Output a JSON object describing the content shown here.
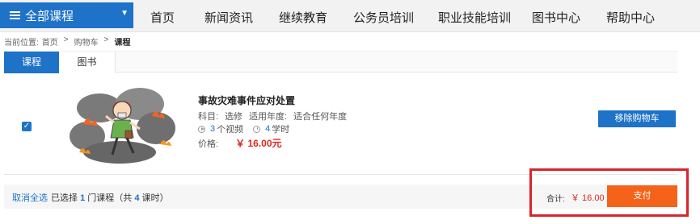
{
  "nav": {
    "all_courses": "全部课程",
    "items": [
      "首页",
      "新闻资讯",
      "继续教育",
      "公务员培训",
      "职业技能培训",
      "图书中心",
      "帮助中心"
    ]
  },
  "breadcrumb": {
    "prefix": "当前位置:",
    "items": [
      "首页",
      "购物车",
      "课程"
    ],
    "separator": ">"
  },
  "tabs": [
    "课程",
    "图书"
  ],
  "course": {
    "checked": true,
    "title": "事故灾难事件应对处置",
    "subject_label": "科目:",
    "subject_value": "选修",
    "year_label": "适用年度:",
    "year_value": "适合任何年度",
    "videos_num": "3",
    "videos_unit": "个视频",
    "hours_num": "4",
    "hours_unit": "学时",
    "price_label": "价格:",
    "price": "￥ 16.00元",
    "remove_label": "移除购物车"
  },
  "footer": {
    "deselect_all": "取消全选",
    "selected_prefix": "已选择",
    "selected_count": "1",
    "selected_mid": "门课程（共",
    "hours_total": "4",
    "selected_suffix": "课时）",
    "total_label": "合计:",
    "total_amount": "￥ 16.00",
    "pay_label": "支付"
  },
  "colors": {
    "primary": "#1e73c8",
    "price": "#e0271f",
    "pay": "#f5631b",
    "highlight_box": "#d9242a"
  }
}
